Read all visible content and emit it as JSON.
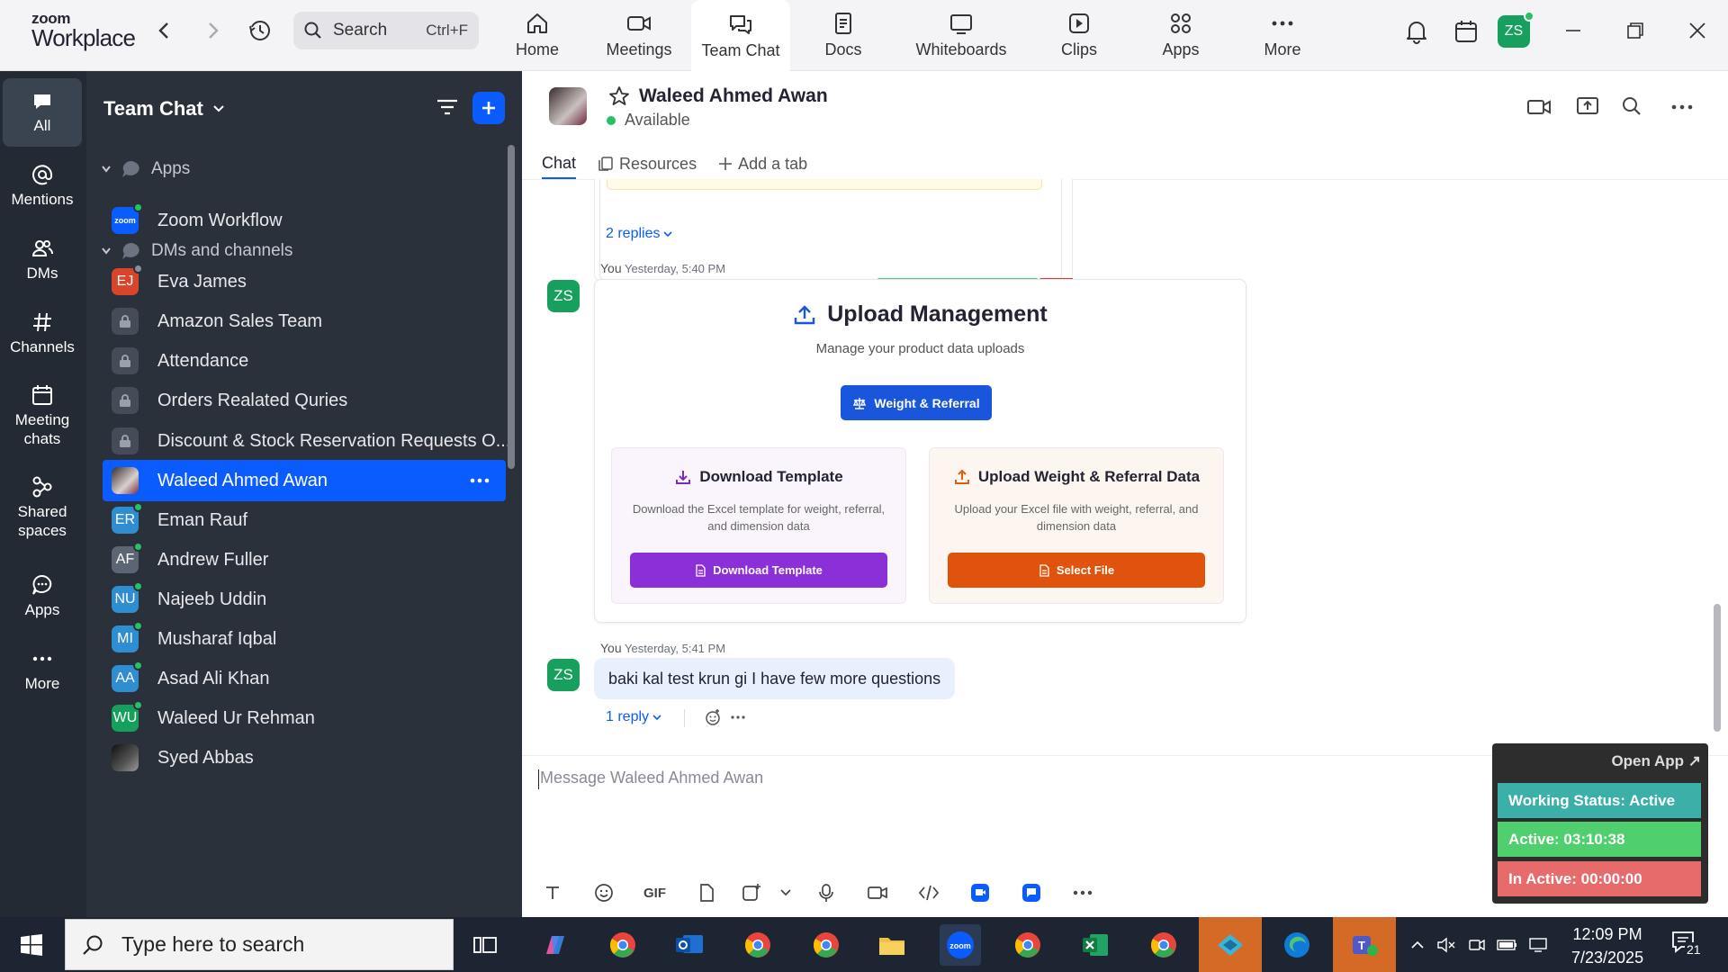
{
  "app": {
    "logo_line1": "zoom",
    "logo_line2": "Workplace"
  },
  "search": {
    "placeholder": "Search",
    "shortcut": "Ctrl+F"
  },
  "nav": {
    "home": "Home",
    "meetings": "Meetings",
    "team_chat": "Team Chat",
    "docs": "Docs",
    "whiteboards": "Whiteboards",
    "clips": "Clips",
    "apps": "Apps",
    "more": "More"
  },
  "user": {
    "initials": "ZS"
  },
  "rail": {
    "all": "All",
    "mentions": "Mentions",
    "dms": "DMs",
    "channels": "Channels",
    "meeting_chats": "Meeting chats",
    "shared_spaces": "Shared spaces",
    "apps": "Apps",
    "more": "More"
  },
  "sidebar": {
    "title": "Team Chat",
    "apps_section": "Apps",
    "zoom_workflow": {
      "icon_text": "zoom",
      "label": "Zoom Workflow"
    },
    "dms_section": "DMs and channels",
    "items": [
      {
        "initials": "EJ",
        "label": "Eva James",
        "color": "#d9452b",
        "type": "person",
        "presence": "clock"
      },
      {
        "initials": "",
        "label": "Amazon Sales Team",
        "type": "channel"
      },
      {
        "initials": "",
        "label": "Attendance",
        "type": "channel"
      },
      {
        "initials": "",
        "label": "Orders Realated Quries",
        "type": "channel"
      },
      {
        "initials": "",
        "label": "Discount & Stock Reservation Requests O...",
        "type": "channel"
      },
      {
        "initials": "",
        "label": "Waleed Ahmed Awan",
        "type": "photo",
        "selected": true
      },
      {
        "initials": "ER",
        "label": "Eman Rauf",
        "color": "#2f8ed1",
        "type": "person",
        "presence": "online"
      },
      {
        "initials": "AF",
        "label": "Andrew Fuller",
        "color": "#5b6574",
        "type": "person",
        "presence": "online"
      },
      {
        "initials": "NU",
        "label": "Najeeb Uddin",
        "color": "#2f8ed1",
        "type": "person",
        "presence": "online"
      },
      {
        "initials": "MI",
        "label": "Musharaf Iqbal",
        "color": "#2f8ed1",
        "type": "person",
        "presence": "online"
      },
      {
        "initials": "AA",
        "label": "Asad Ali Khan",
        "color": "#2f8ed1",
        "type": "person",
        "presence": "online"
      },
      {
        "initials": "WU",
        "label": "Waleed Ur Rehman",
        "color": "#17a05d",
        "type": "person",
        "presence": "online"
      },
      {
        "initials": "",
        "label": "Syed Abbas",
        "type": "photo2"
      }
    ]
  },
  "chat": {
    "name": "Waleed Ahmed Awan",
    "status": "Available",
    "tabs": {
      "chat": "Chat",
      "resources": "Resources",
      "add_tab": "Add a tab"
    },
    "first_thread_replies": "2 replies",
    "messages": [
      {
        "sender": "You",
        "time": "Yesterday, 5:40 PM",
        "avatar": "ZS",
        "card": {
          "title": "Upload Management",
          "subtitle": "Manage your product data uploads",
          "primary_button": "Weight & Referral",
          "left": {
            "title": "Download Template",
            "desc": "Download the Excel template for weight, referral, and dimension data",
            "button": "Download Template"
          },
          "right": {
            "title": "Upload Weight & Referral Data",
            "desc": "Upload your Excel file with weight, referral, and dimension data",
            "button": "Select File"
          }
        }
      },
      {
        "sender": "You",
        "time": "Yesterday, 5:41 PM",
        "avatar": "ZS",
        "text": "baki kal test krun gi I have few more questions",
        "replies": "1 reply"
      }
    ],
    "composer_placeholder": "Message Waleed Ahmed Awan",
    "toolbar_gif": "GIF"
  },
  "widget": {
    "open_app": "Open App ↗",
    "working_status": "Working Status: Active",
    "active": "Active: 03:10:38",
    "inactive": "In Active: 00:00:00",
    "colors": {
      "working": "#3ab0a8",
      "active": "#4fcf6e",
      "inactive": "#e86b6b"
    }
  },
  "taskbar": {
    "search_placeholder": "Type here to search",
    "time": "12:09 PM",
    "date": "7/23/2025",
    "notification_count": "21"
  }
}
